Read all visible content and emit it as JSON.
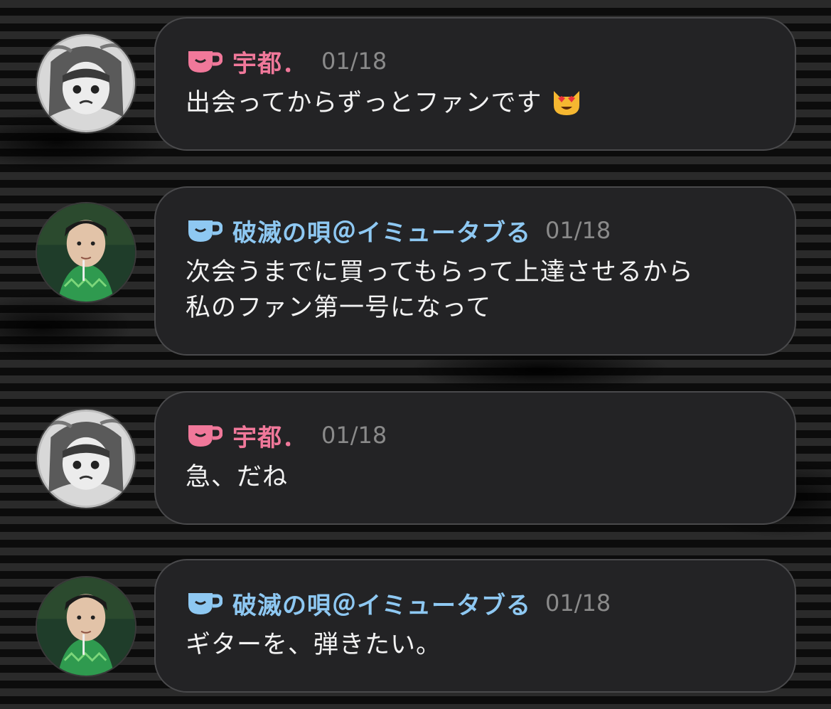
{
  "colors": {
    "pink_sender": "#f0789a",
    "blue_sender": "#8ec8f2",
    "bubble_bg": "#232325",
    "bubble_border": "#4a4a4c",
    "date": "#8a8a8a",
    "text": "#f2f2f2"
  },
  "messages": [
    {
      "sender": "宇都．",
      "date": "01/18",
      "text": "出会ってからずっとファンです",
      "emoji": "smiling-cat-heart-eyes-icon",
      "icon": "cup-icon"
    },
    {
      "sender": "破滅の唄＠イミュータブる",
      "date": "01/18",
      "text": "次会うまでに買ってもらって上達させるから\n私のファン第一号になって",
      "icon": "cup-icon"
    },
    {
      "sender": "宇都．",
      "date": "01/18",
      "text": "急、だね",
      "icon": "cup-icon"
    },
    {
      "sender": "破滅の唄＠イミュータブる",
      "date": "01/18",
      "text": "ギターを、弾きたい。",
      "icon": "cup-icon"
    }
  ]
}
